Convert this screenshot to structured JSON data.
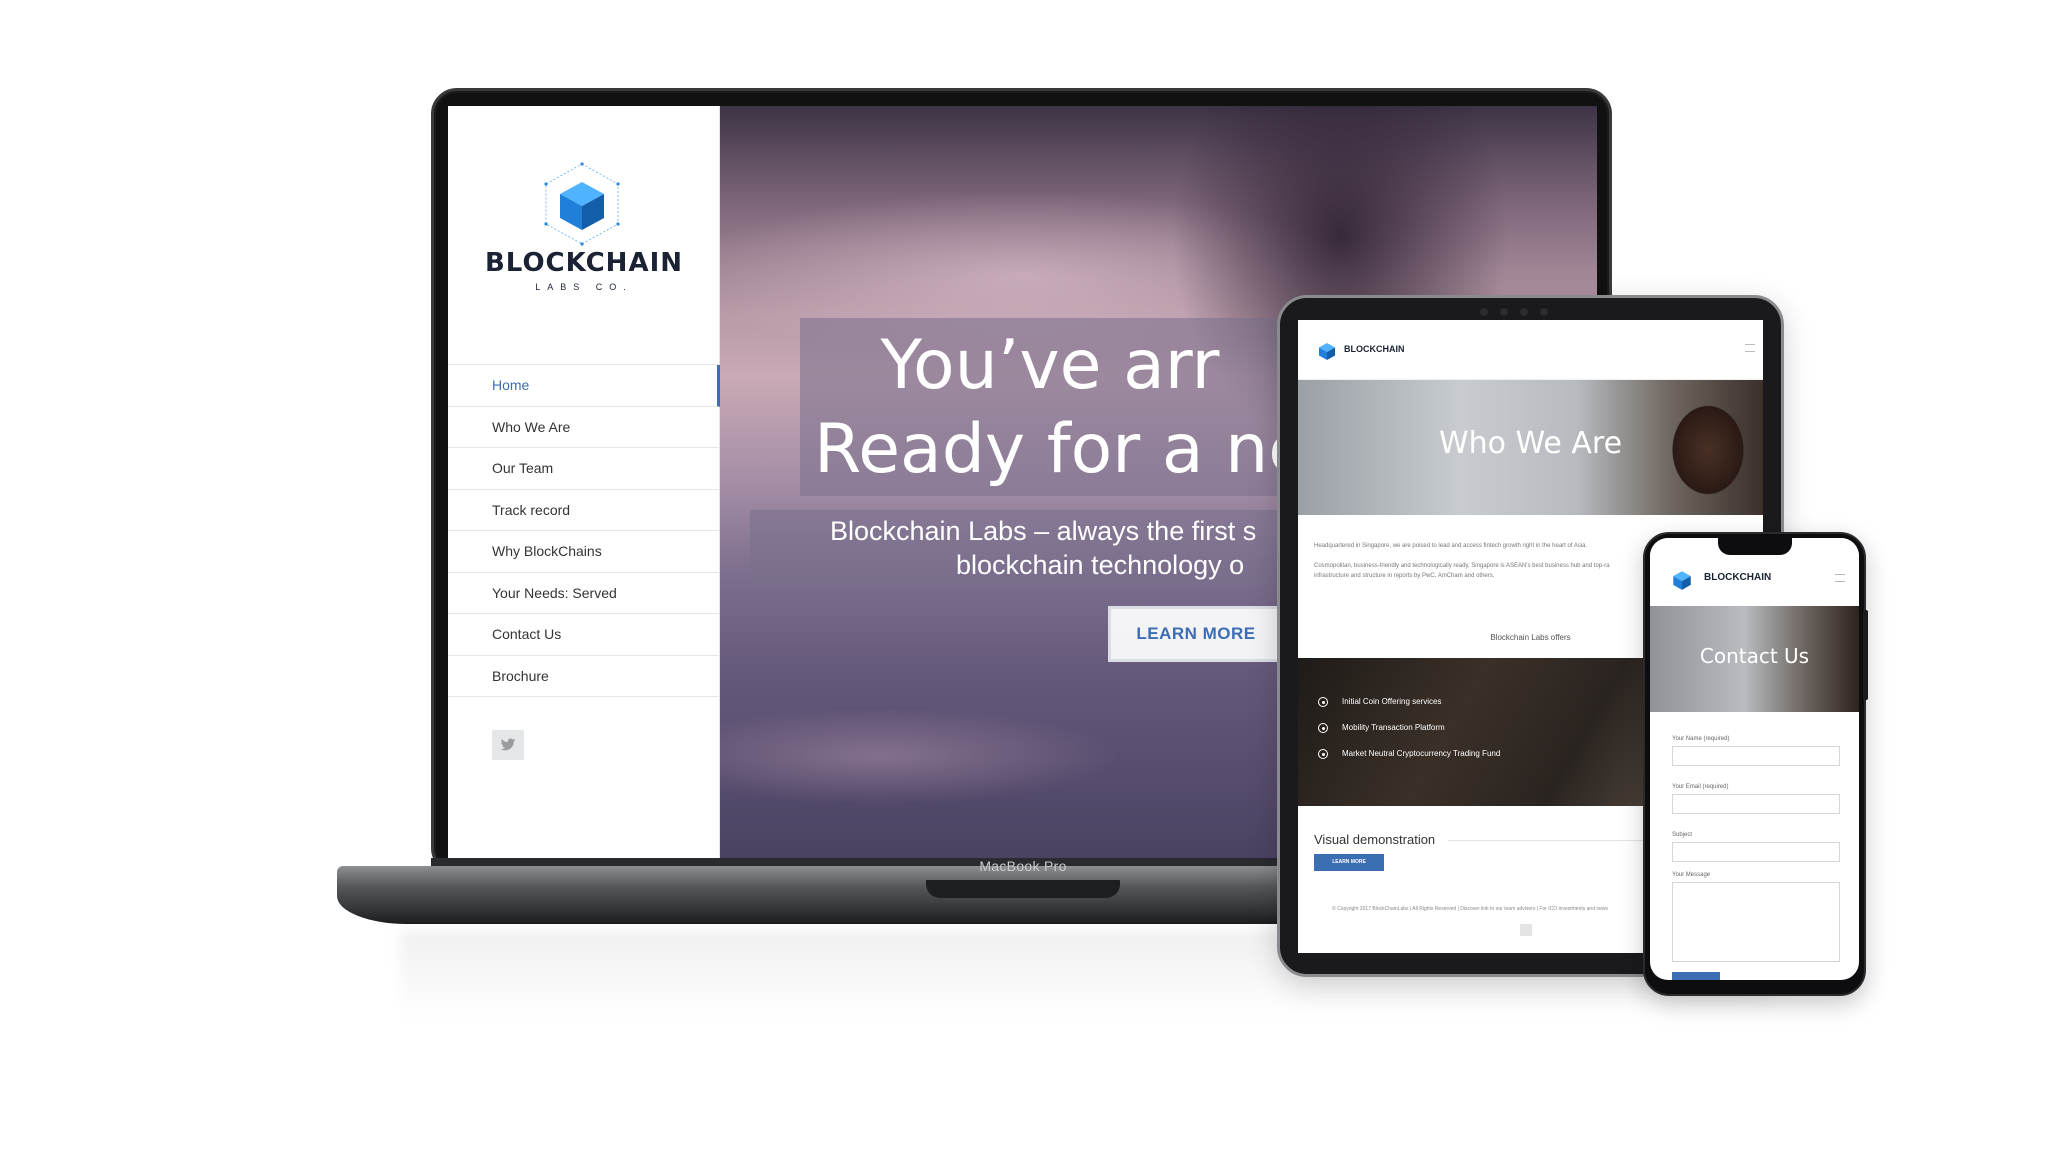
{
  "colors": {
    "accent": "#3c6eb4",
    "logo_blue": "#1e88e5",
    "dark_text": "#1a2233"
  },
  "laptop": {
    "device_label": "MacBook Pro",
    "logo": {
      "name": "BLOCKCHAIN",
      "subtitle": "LABS CO."
    },
    "nav_items": [
      "Home",
      "Who We Are",
      "Our Team",
      "Track record",
      "Why BlockChains",
      "Your Needs: Served",
      "Contact Us",
      "Brochure"
    ],
    "active_nav": "Home",
    "social_icon": "twitter-icon",
    "hero": {
      "headline_line1": "You’ve arr",
      "headline_line2": "Ready for a ne",
      "subline1": "Blockchain Labs – always the first s",
      "subline2": "blockchain technology o",
      "cta_label": "LEARN MORE"
    }
  },
  "tablet": {
    "logo_name": "BLOCKCHAIN",
    "hero_title": "Who We Are",
    "paragraph1": "Headquartered in Singapore, we are poised to lead and access fintech growth right in the heart of Asia.",
    "paragraph2": "Cosmopolitan, business-friendly and technologically ready, Singapore is ASEAN's best business hub and top-ra",
    "paragraph3": "infrastructure and structure in reports by PwC, AmCham and others.",
    "offers_heading": "Blockchain Labs offers",
    "offers": [
      "Initial Coin Offering services",
      "Mobility Transaction Platform",
      "Market Neutral Cryptocurrency Trading Fund"
    ],
    "visual_heading": "Visual demonstration",
    "button_label": "LEARN MORE",
    "footer_text": "© Copyright 2017 BlockChainLabs  |  All Rights Reserved  |  Discover link to our team advisers  |  For ICO investments and news"
  },
  "phone": {
    "logo_name": "BLOCKCHAIN",
    "hero_title": "Contact Us",
    "form": {
      "name_label": "Your Name (required)",
      "email_label": "Your Email (required)",
      "subject_label": "Subject",
      "message_label": "Your Message"
    }
  }
}
